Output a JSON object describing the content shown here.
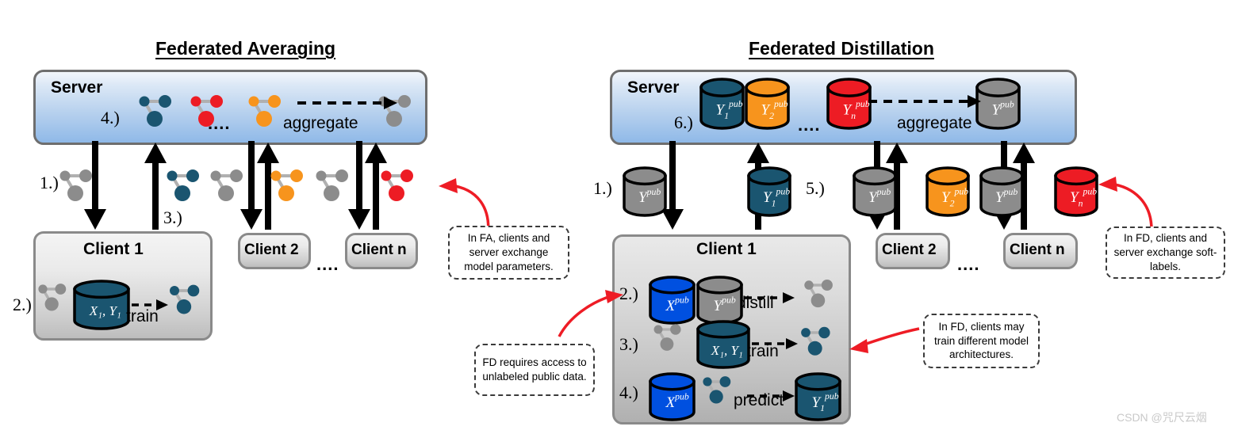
{
  "panels": [
    {
      "id": "federated-averaging",
      "title": "Federated Averaging",
      "server": {
        "label": "Server",
        "step": "4.)",
        "aggregate_label": "aggregate",
        "ellipsis": "....",
        "model_colors": [
          "#1a5570",
          "#ed1c24",
          "#f7941d",
          "#8c8c8c"
        ]
      },
      "steps": {
        "download": "1.)",
        "upload": "3.)",
        "train": "2.)"
      },
      "clients": [
        {
          "label": "Client 1",
          "color": "#1a5570"
        },
        {
          "label": "Client 2",
          "color": "#f7941d"
        },
        {
          "label": "Client n",
          "color": "#ed1c24"
        }
      ],
      "client_ellipsis": "....",
      "client1_detail": {
        "db_label": "X₁, Y₁",
        "verb": "train",
        "in_color": "#8c8c8c",
        "out_color": "#1a5570",
        "db_color": "#1a5570"
      }
    },
    {
      "id": "federated-distillation",
      "title": "Federated Distillation",
      "server": {
        "label": "Server",
        "step": "6.)",
        "aggregate_label": "aggregate",
        "ellipsis": "....",
        "cylinders": [
          {
            "base": "Y",
            "sup": "pub",
            "sub": "1",
            "color": "#1a5570"
          },
          {
            "base": "Y",
            "sup": "pub",
            "sub": "2",
            "color": "#f7941d"
          },
          {
            "base": "Y",
            "sup": "pub",
            "sub": "n",
            "color": "#ed1c24"
          },
          {
            "base": "Y",
            "sup": "pub",
            "sub": "",
            "color": "#8c8c8c"
          }
        ]
      },
      "steps": {
        "download": "1.)",
        "upload": "5.)",
        "distill": "2.)",
        "train": "3.)",
        "predict": "4.)"
      },
      "down_cylinders": [
        {
          "base": "Y",
          "sup": "pub",
          "sub": "",
          "color": "#8c8c8c"
        },
        {
          "base": "Y",
          "sup": "pub",
          "sub": "",
          "color": "#8c8c8c"
        },
        {
          "base": "Y",
          "sup": "pub",
          "sub": "",
          "color": "#8c8c8c"
        }
      ],
      "up_cylinders": [
        {
          "base": "Y",
          "sup": "pub",
          "sub": "1",
          "color": "#1a5570"
        },
        {
          "base": "Y",
          "sup": "pub",
          "sub": "2",
          "color": "#f7941d"
        },
        {
          "base": "Y",
          "sup": "pub",
          "sub": "n",
          "color": "#ed1c24"
        }
      ],
      "clients": [
        {
          "label": "Client 1"
        },
        {
          "label": "Client 2"
        },
        {
          "label": "Client n"
        }
      ],
      "client_ellipsis": "....",
      "client1_rows": [
        {
          "step": "2.)",
          "verb": "distill",
          "db1": {
            "base": "X",
            "sup": "pub",
            "sub": "",
            "color": "#0050e0"
          },
          "db2": {
            "base": "Y",
            "sup": "pub",
            "sub": "",
            "color": "#8c8c8c"
          },
          "out_model_color": "#8c8c8c"
        },
        {
          "step": "3.)",
          "verb": "train",
          "db1": {
            "base": "X₁, Y₁",
            "sup": "",
            "sub": "",
            "color": "#1a5570"
          },
          "in_model_color": "#8c8c8c",
          "out_model_color": "#1a5570"
        },
        {
          "step": "4.)",
          "verb": "predict",
          "db1": {
            "base": "X",
            "sup": "pub",
            "sub": "",
            "color": "#0050e0"
          },
          "in_model_color": "#1a5570",
          "db_out": {
            "base": "Y",
            "sup": "pub",
            "sub": "1",
            "color": "#1a5570"
          }
        }
      ]
    }
  ],
  "annotations": [
    {
      "id": "fa-note",
      "text": "In FA, clients and server exchange model parameters."
    },
    {
      "id": "fd-public-note",
      "text": "FD requires access to unlabeled public data."
    },
    {
      "id": "fd-arch-note",
      "text": "In FD, clients may train different model architectures."
    },
    {
      "id": "fd-soft-note",
      "text": "In FD, clients and server exchange soft-labels."
    }
  ],
  "colors": {
    "teal": "#1a5570",
    "orange": "#f7941d",
    "red": "#ed1c24",
    "gray": "#8c8c8c",
    "blue": "#0050e0",
    "arrow_red": "#ee1c25",
    "black": "#000000"
  },
  "watermark": "CSDN @咒尺云烟"
}
